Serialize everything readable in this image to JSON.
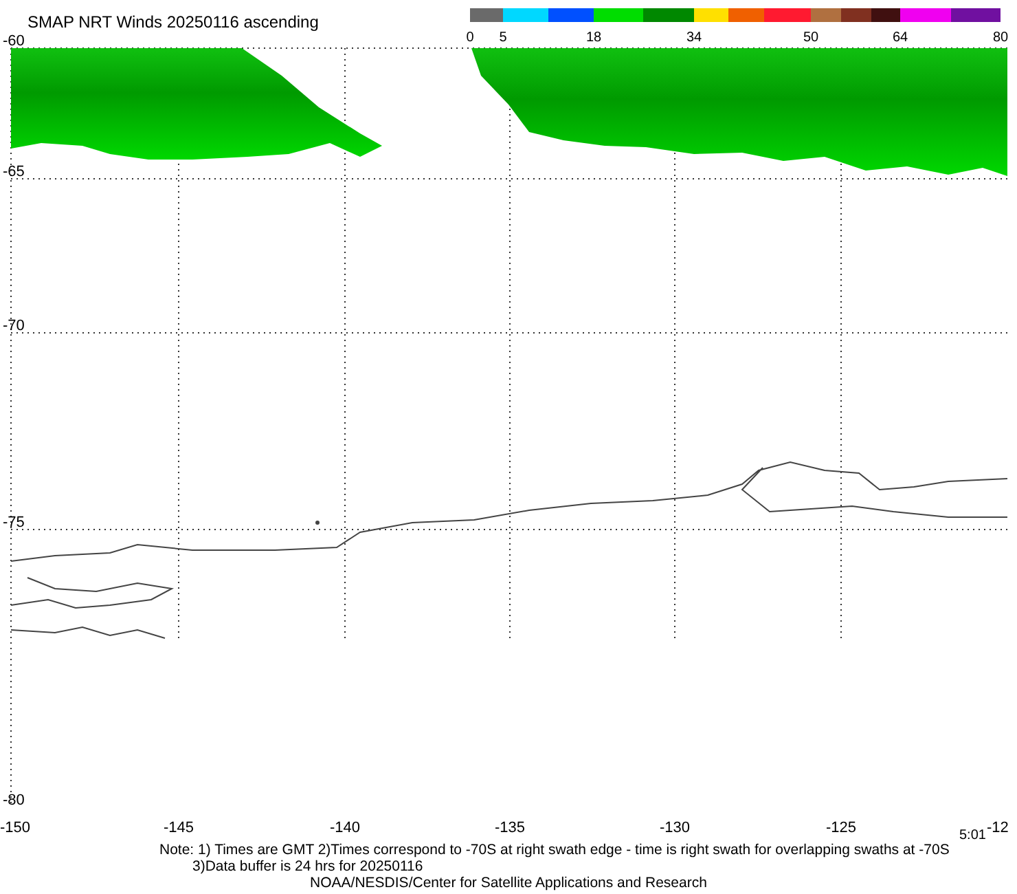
{
  "title": "SMAP NRT Winds 20250116 ascending",
  "colorbar": {
    "segments": [
      {
        "color": "#6a6a6a"
      },
      {
        "color": "#00d8ff"
      },
      {
        "color": "#0050ff"
      },
      {
        "color": "#00dd00"
      },
      {
        "color": "#008800"
      },
      {
        "color": "#ffe000"
      },
      {
        "color": "#f06000"
      },
      {
        "color": "#ff1a30"
      },
      {
        "color": "#b07040"
      },
      {
        "color": "#803020"
      },
      {
        "color": "#401010"
      },
      {
        "color": "#f000f0"
      },
      {
        "color": "#7010a0"
      }
    ],
    "labels": [
      "0",
      "5",
      "18",
      "34",
      "50",
      "64",
      "80"
    ]
  },
  "map": {
    "latitude_labels": [
      "-60",
      "-65",
      "-70",
      "-75",
      "-80"
    ],
    "longitude_labels": [
      "-150",
      "-145",
      "-140",
      "-135",
      "-130",
      "-125",
      "-12"
    ],
    "time_label": "5:01"
  },
  "notes": [
    "Note: 1) Times are GMT 2)Times correspond to -70S at right swath edge - time is right swath for overlapping swaths at -70S",
    "3)Data buffer is 24 hrs for 20250116",
    "NOAA/NESDIS/Center for Satellite Applications and Research"
  ]
}
